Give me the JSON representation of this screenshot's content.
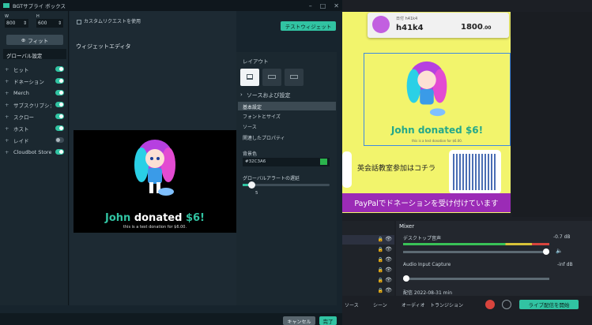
{
  "window": {
    "title": "BGTサプライ ボックス"
  },
  "left": {
    "stepper_w": "800",
    "stepper_h": "600",
    "checkbox_label": "カスタムリクエストを使用",
    "fit_button": "フィット",
    "global_settings": "グローバル設定",
    "items": [
      {
        "label": "ヒット",
        "on": true
      },
      {
        "label": "ドネーション",
        "on": true
      },
      {
        "label": "Merch",
        "on": true
      },
      {
        "label": "サブスクリプション",
        "on": true
      },
      {
        "label": "スクロー",
        "on": true
      },
      {
        "label": "ホスト",
        "on": true
      },
      {
        "label": "レイド",
        "on": false
      },
      {
        "label": "Cloudbot Store",
        "on": true
      }
    ]
  },
  "mid": {
    "header": "ウィジェットエディタ",
    "widget_button": "テストウィジェット",
    "alert_text": "John donated $6!",
    "alert_name": "John",
    "alert_sub": "this is a test donation for $6.00."
  },
  "right": {
    "layout_label": "レイアウト",
    "section_label": "ソースおよび設定",
    "basic": "基本設定",
    "font": "フォントとサイズ",
    "source": "ソース",
    "properties": "関連したプロパティ",
    "bg_label": "背景色",
    "bg_value": "#32C3A6",
    "opacity_label": "グローバルアラートの遅延",
    "slider_value": "5",
    "slider_level": 0.1
  },
  "bottom": {
    "cancel": "キャンセル",
    "done": "完了"
  },
  "obs": {
    "username": "h41k4",
    "user_sub": "日付 h41k4",
    "counter": "1800",
    "counter_suffix": ".00",
    "jp_text": "英会話教室参加はコチラ",
    "paypal_text": "PayPalでドネーションを受け付けています",
    "mixer_title": "Mixer",
    "track1": "デスクトップ音声",
    "track1_db": "-0.7 dB",
    "track2": "Audio Input Capture",
    "track2_db": "-inf dB",
    "track3": "配信 2022-08-31 min",
    "dock_tabs": [
      "ソース",
      "シーン",
      "オーディオ",
      "トランジション"
    ],
    "dock_btn": "ライブ配信を開始",
    "dock_btn2": "録画開始"
  },
  "colors": {
    "accent": "#31c3a2",
    "canvas": "#f2f46c",
    "purple": "#9b2bb6"
  }
}
